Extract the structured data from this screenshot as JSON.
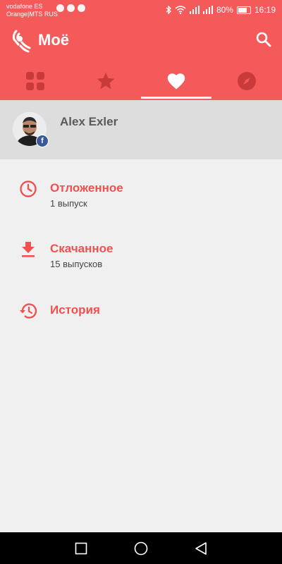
{
  "status_bar": {
    "carrier_1": "vodafone ES",
    "carrier_2": "Orange|MTS RUS",
    "battery_percent": "80%",
    "time": "16:19"
  },
  "app_bar": {
    "title": "Моё",
    "accent_color": "#f55a5a",
    "logo_icon": "podcast-signal-icon",
    "search_icon": "search-icon"
  },
  "tabs": [
    {
      "icon": "grid-icon",
      "active": false
    },
    {
      "icon": "star-icon",
      "active": false
    },
    {
      "icon": "heart-icon",
      "active": true
    },
    {
      "icon": "compass-icon",
      "active": false
    }
  ],
  "profile": {
    "name": "Alex Exler",
    "badge": "f"
  },
  "menu": {
    "items": [
      {
        "icon": "clock-icon",
        "title": "Отложенное",
        "subtitle": "1 выпуск"
      },
      {
        "icon": "download-icon",
        "title": "Скачанное",
        "subtitle": "15 выпусков"
      },
      {
        "icon": "history-icon",
        "title": "История",
        "subtitle": ""
      }
    ]
  }
}
